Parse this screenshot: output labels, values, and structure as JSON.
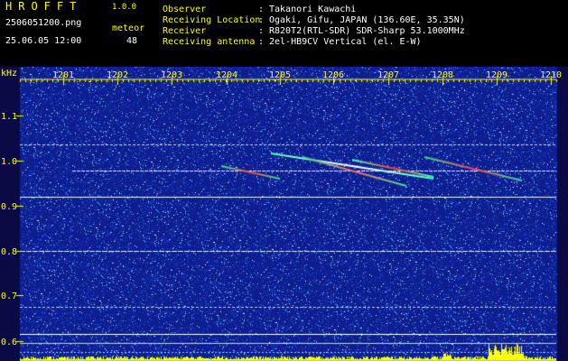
{
  "header": {
    "app_title": "HROFFT",
    "app_version": "1.0.0",
    "file_name": "2506051200.png",
    "datetime": "25.06.05 12:00",
    "meteor_label": "meteor",
    "meteor_count": "48"
  },
  "info": [
    {
      "label": "Observer",
      "value": "Takanori Kawachi"
    },
    {
      "label": "Receiving Location",
      "value": "Ogaki, Gifu, JAPAN (136.60E, 35.35N)"
    },
    {
      "label": "Receiver",
      "value": "R820T2(RTL-SDR) SDR-Sharp 53.1000MHz"
    },
    {
      "label": "Receiving antenna",
      "value": "2el-HB9CV Vertical (el. E-W)"
    }
  ],
  "spectrogram": {
    "unit_label": "kHz",
    "x_ticks": [
      "1201",
      "1202",
      "1203",
      "1204",
      "1205",
      "1206",
      "1207",
      "1208",
      "1209",
      "1210"
    ],
    "y_ticks": [
      "1.1",
      "1.0",
      "0.9",
      "0.8",
      "0.7",
      "0.6"
    ],
    "background_color": "#10208a",
    "label_color": "#ffff00"
  }
}
